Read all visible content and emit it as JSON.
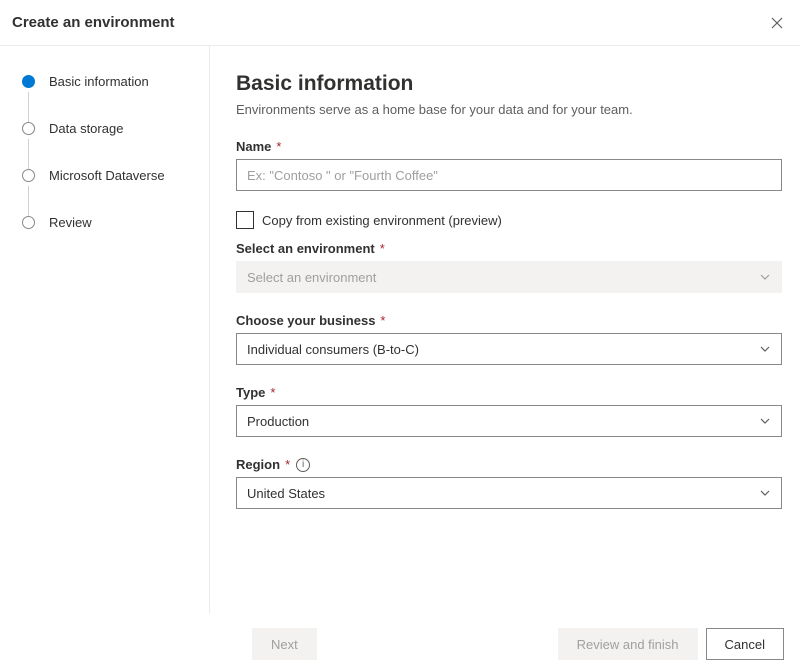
{
  "header": {
    "title": "Create an environment"
  },
  "steps": [
    {
      "label": "Basic information",
      "active": true
    },
    {
      "label": "Data storage",
      "active": false
    },
    {
      "label": "Microsoft Dataverse",
      "active": false
    },
    {
      "label": "Review",
      "active": false
    }
  ],
  "main": {
    "title": "Basic information",
    "description": "Environments serve as a home base for your data and for your team.",
    "name_label": "Name",
    "name_placeholder": "Ex: \"Contoso \" or \"Fourth Coffee\"",
    "copy_checkbox_label": "Copy from existing environment (preview)",
    "select_env_label": "Select an environment",
    "select_env_placeholder": "Select an environment",
    "business_label": "Choose your business",
    "business_value": "Individual consumers (B-to-C)",
    "type_label": "Type",
    "type_value": "Production",
    "region_label": "Region",
    "region_value": "United States"
  },
  "footer": {
    "next": "Next",
    "review": "Review and finish",
    "cancel": "Cancel"
  }
}
